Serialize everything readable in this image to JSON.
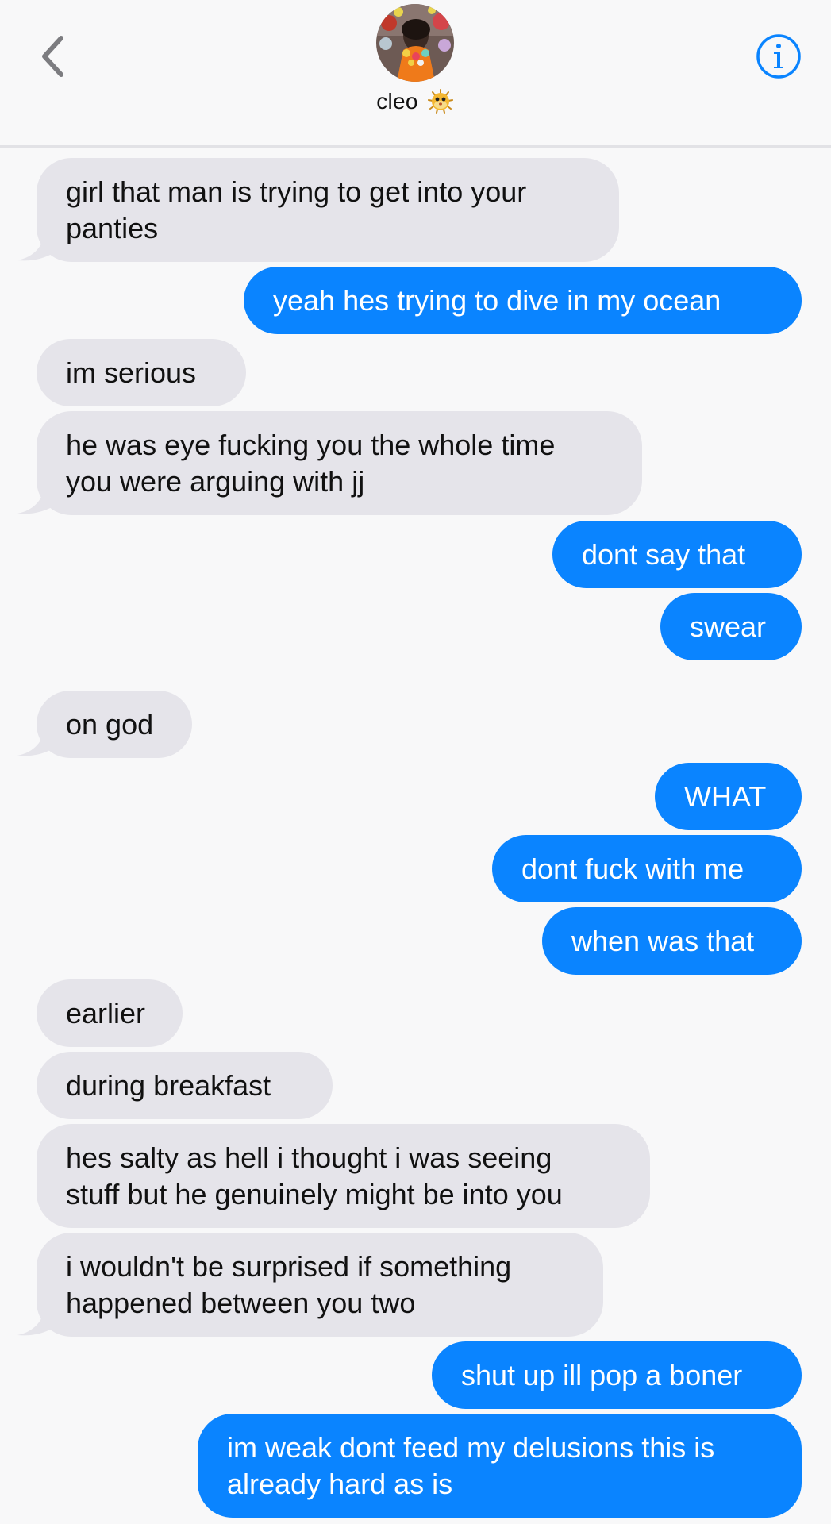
{
  "header": {
    "contact_name": "cleo",
    "back_icon": "chevron-left-icon",
    "info_icon": "info-circle-icon",
    "name_emoji": "pufferfish-emoji",
    "accent_color": "#0a84ff"
  },
  "messages": [
    {
      "from": "them",
      "text": "girl that man is trying to get into your\npanties"
    },
    {
      "from": "me",
      "text": "yeah hes trying to dive in my ocean"
    },
    {
      "from": "them",
      "text": "im serious"
    },
    {
      "from": "them",
      "text": "he was eye fucking you the whole time\nyou were arguing with jj"
    },
    {
      "from": "me",
      "text": "dont say that"
    },
    {
      "from": "me",
      "text": "swear"
    },
    {
      "from": "them",
      "text": "on god"
    },
    {
      "from": "me",
      "text": "WHAT"
    },
    {
      "from": "me",
      "text": "dont fuck with me"
    },
    {
      "from": "me",
      "text": "when was that"
    },
    {
      "from": "them",
      "text": "earlier"
    },
    {
      "from": "them",
      "text": "during breakfast"
    },
    {
      "from": "them",
      "text": "hes salty as hell i thought i was seeing\nstuff but he genuinely might be into you"
    },
    {
      "from": "them",
      "text": "i wouldn't be surprised if something\nhappened between you two"
    },
    {
      "from": "me",
      "text": "shut up ill pop a boner"
    },
    {
      "from": "me",
      "text": "im weak dont feed my delusions this is\nalready hard as is"
    }
  ],
  "colors": {
    "received_bubble": "#e5e4ea",
    "sent_bubble": "#0a84ff",
    "background": "#f8f8f9"
  }
}
